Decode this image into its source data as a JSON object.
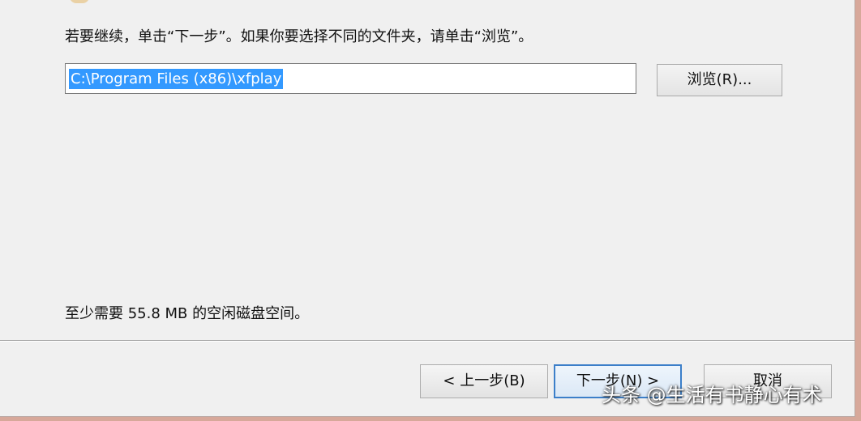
{
  "installer": {
    "instruction": "若要继续，单击“下一步”。如果你要选择不同的文件夹，请单击“浏览”。",
    "install_path": "C:\\Program Files (x86)\\xfplay",
    "browse_label": "浏览(R)...",
    "disk_space_text": "至少需要 55.8 MB 的空闲磁盘空间。"
  },
  "footer": {
    "back_label": "< 上一步(B)",
    "next_label": "下一步(N) >",
    "cancel_label": "取消"
  },
  "watermark": {
    "text": "头条 @生活有书静心有术"
  },
  "colors": {
    "dialog_background": "#f0f0f0",
    "selection_highlight": "#3399ff",
    "default_button_border": "#3c7fc9",
    "outer_border": "#d7a89a"
  }
}
